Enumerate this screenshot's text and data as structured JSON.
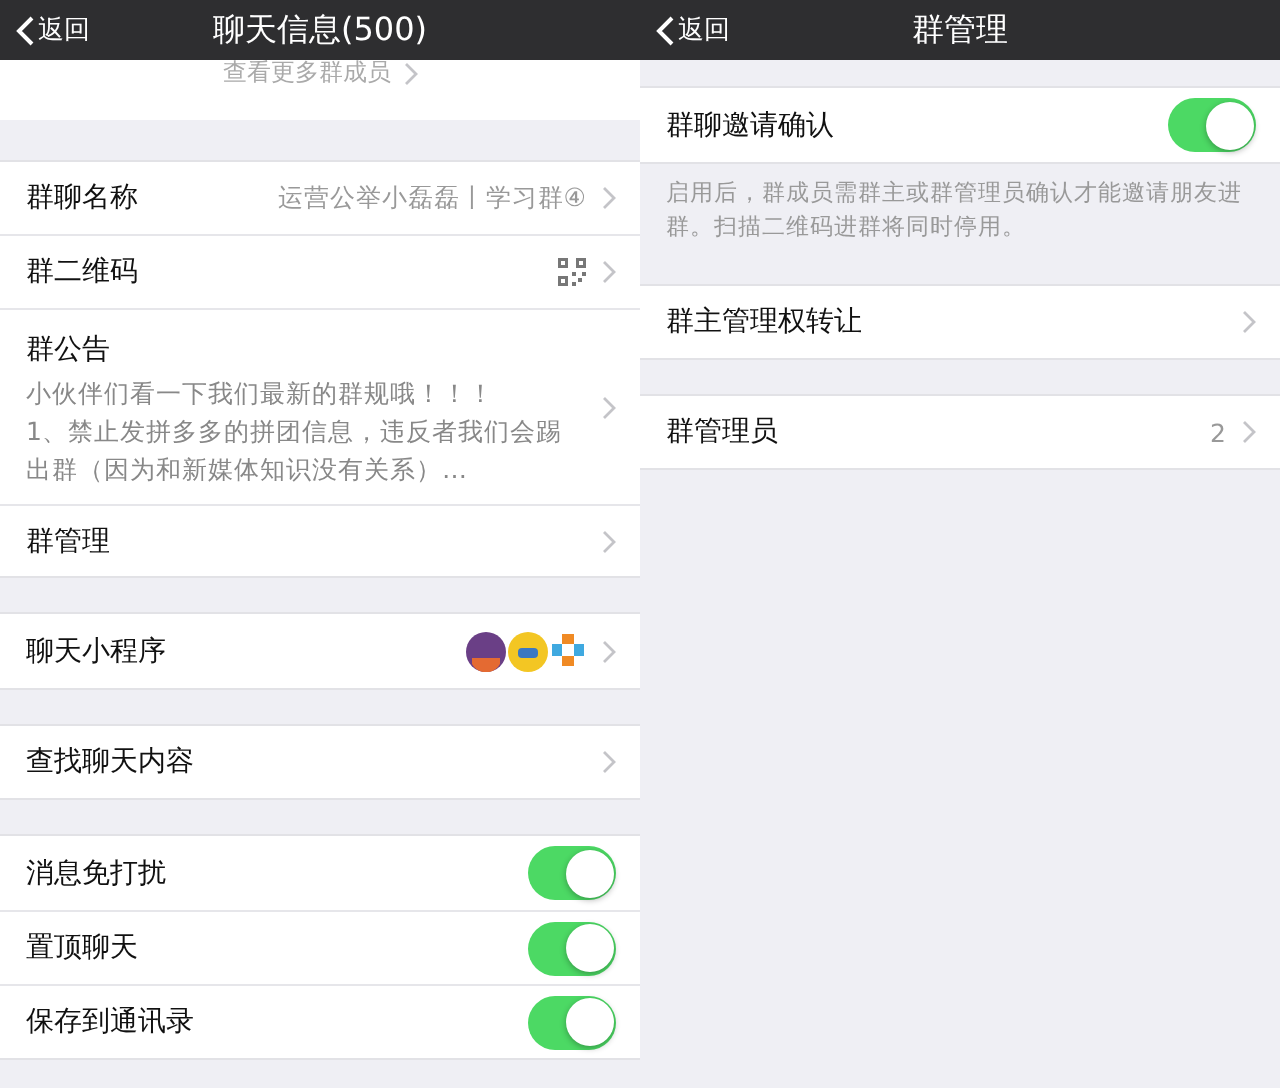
{
  "screens": [
    {
      "nav": {
        "back": "返回",
        "title": "聊天信息(500)"
      },
      "members_link": "查看更多群成员",
      "groups": [
        {
          "rows": [
            {
              "kind": "value",
              "label": "群聊名称",
              "value": "运营公举小磊磊丨学习群④"
            },
            {
              "kind": "qr",
              "label": "群二维码"
            },
            {
              "kind": "notice",
              "label": "群公告",
              "lines": [
                "小伙伴们看一下我们最新的群规哦！！！",
                "1、禁止发拼多多的拼团信息，违反者我们会踢出群（因为和新媒体知识没有关系）…"
              ]
            },
            {
              "kind": "link",
              "label": "群管理"
            }
          ]
        },
        {
          "rows": [
            {
              "kind": "apps",
              "label": "聊天小程序"
            }
          ]
        },
        {
          "rows": [
            {
              "kind": "link",
              "label": "查找聊天内容"
            }
          ]
        },
        {
          "rows": [
            {
              "kind": "toggle",
              "label": "消息免打扰",
              "on": true
            },
            {
              "kind": "toggle",
              "label": "置顶聊天",
              "on": true
            },
            {
              "kind": "toggle",
              "label": "保存到通讯录",
              "on": true
            }
          ]
        }
      ]
    },
    {
      "nav": {
        "back": "返回",
        "title": "群管理"
      },
      "groups": [
        {
          "rows": [
            {
              "kind": "toggle",
              "label": "群聊邀请确认",
              "on": true
            }
          ],
          "footnote": "启用后，群成员需群主或群管理员确认才能邀请朋友进群。扫描二维码进群将同时停用。"
        },
        {
          "rows": [
            {
              "kind": "link",
              "label": "群主管理权转让"
            }
          ]
        },
        {
          "rows": [
            {
              "kind": "value",
              "label": "群管理员",
              "value": "2"
            }
          ]
        }
      ]
    }
  ]
}
